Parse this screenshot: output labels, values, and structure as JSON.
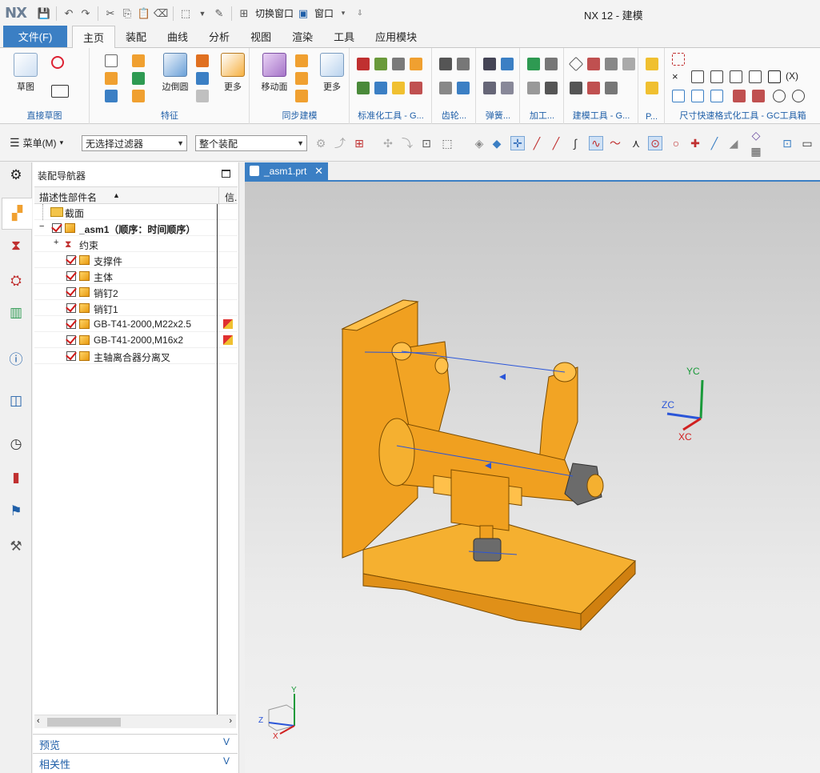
{
  "app": {
    "logo": "NX",
    "window_title": "NX 12 - 建模",
    "quick_access": {
      "switch_window": "切换窗口",
      "window_menu": "窗口"
    }
  },
  "ribbon_tabs": [
    "主页",
    "装配",
    "曲线",
    "分析",
    "视图",
    "渲染",
    "工具",
    "应用模块"
  ],
  "file_tab": "文件(F)",
  "ribbon_groups": {
    "sketch": {
      "label": "直接草图",
      "button": "草图"
    },
    "feature": {
      "label": "特征",
      "edge_blend": "边倒圆",
      "more": "更多"
    },
    "sync": {
      "label": "同步建模",
      "move_face": "移动面",
      "more": "更多"
    },
    "standard": "标准化工具 - G...",
    "gear": "齿轮...",
    "spring": "弹簧...",
    "machining": "加工...",
    "modeling_tools": "建模工具 - G...",
    "p": "P...",
    "dim_fast": "尺寸快速格式化工具 - GC工具箱"
  },
  "command_bar": {
    "menu": "菜单(M)",
    "filter": "无选择过滤器",
    "scope": "整个装配"
  },
  "navigator": {
    "title": "装配导航器",
    "col_name": "描述性部件名",
    "col_info": "信.",
    "rows": [
      {
        "label": "截面",
        "kind": "folder",
        "indent": 0
      },
      {
        "label": "_asm1（顺序：时间顺序）",
        "kind": "assembly",
        "indent": 0
      },
      {
        "label": "约束",
        "kind": "constraints",
        "indent": 1
      },
      {
        "label": "支撑件",
        "kind": "part",
        "indent": 2
      },
      {
        "label": "主体",
        "kind": "part",
        "indent": 2
      },
      {
        "label": "销钉2",
        "kind": "part",
        "indent": 2
      },
      {
        "label": "销钉1",
        "kind": "part",
        "indent": 2
      },
      {
        "label": "GB-T41-2000,M22x2.5",
        "kind": "part",
        "indent": 2,
        "info_icon": true
      },
      {
        "label": "GB-T41-2000,M16x2",
        "kind": "part",
        "indent": 2,
        "info_icon": true
      },
      {
        "label": "主轴离合器分离叉",
        "kind": "part",
        "indent": 2
      }
    ],
    "sections": {
      "preview": "预览",
      "dependencies": "相关性"
    }
  },
  "document_tab": "_asm1.prt",
  "viewport": {
    "triad_labels": {
      "yc": "YC",
      "zc": "ZC",
      "xc": "XC",
      "y": "Y",
      "z": "Z",
      "x": "X"
    },
    "model_color": "#f5a623"
  },
  "colors": {
    "accent": "#3b7fc4",
    "model": "#f5a623",
    "dimension": "#2a55d8"
  }
}
